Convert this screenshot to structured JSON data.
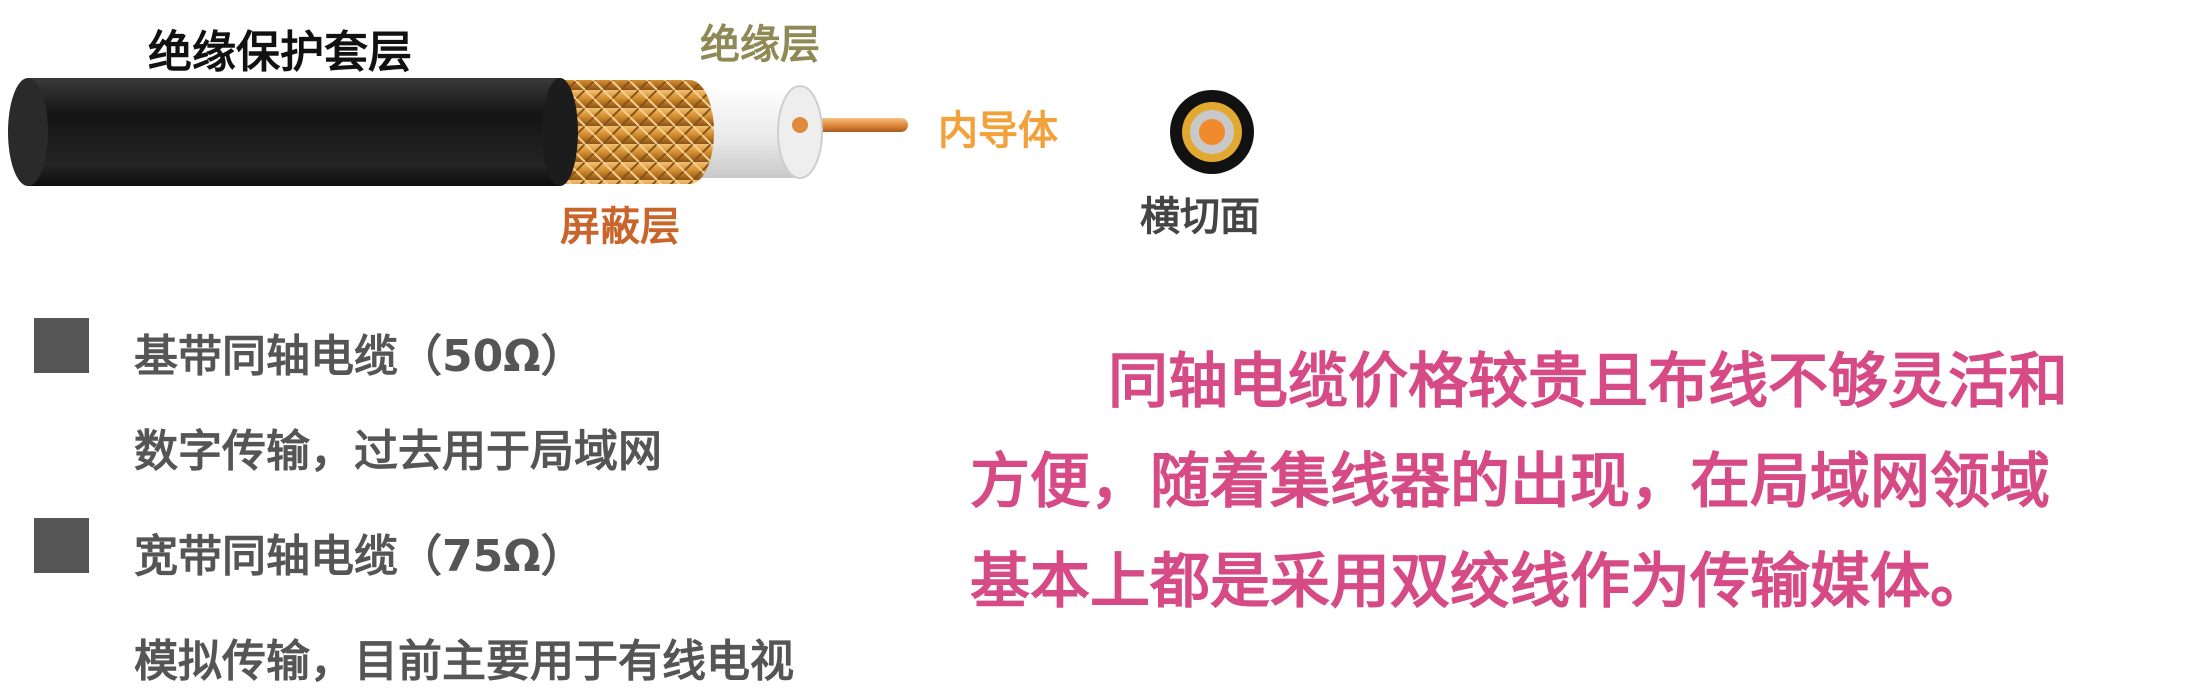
{
  "diagram": {
    "labels": {
      "jacket": "绝缘保护套层",
      "insulation": "绝缘层",
      "inner_conductor": "内导体",
      "shield": "屏蔽层",
      "cross_section": "横切面"
    },
    "colors": {
      "jacket": "#1a1a1a",
      "shield": "#d9923a",
      "insulation": "#f2f2f2",
      "conductor": "#e08a3c",
      "note": "#d64a86"
    }
  },
  "list": {
    "items": [
      {
        "title": "基带同轴电缆（50Ω）",
        "desc": "数字传输，过去用于局域网"
      },
      {
        "title": "宽带同轴电缆（75Ω）",
        "desc": "模拟传输，目前主要用于有线电视"
      }
    ]
  },
  "note": {
    "lines": [
      "同轴电缆价格较贵且布线不够灵活和",
      "方便，随着集线器的出现，在局域网领域",
      "基本上都是采用双绞线作为传输媒体。"
    ]
  }
}
